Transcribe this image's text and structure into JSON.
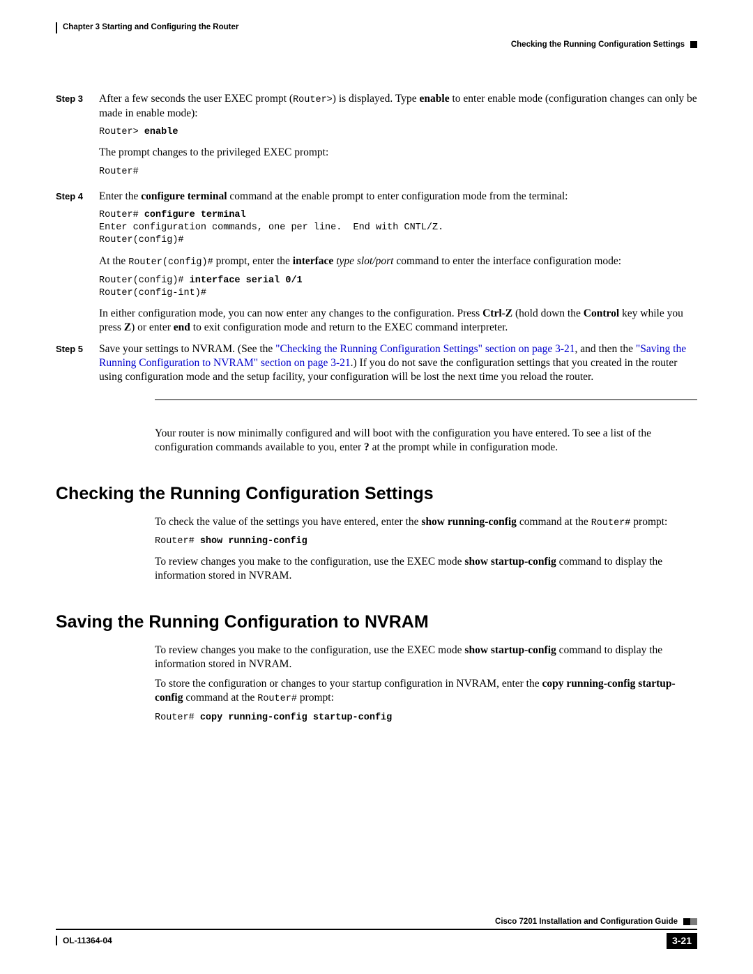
{
  "header": {
    "chapter": "Chapter 3      Starting and Configuring the Router",
    "section": "Checking the Running Configuration Settings"
  },
  "steps": {
    "s3": {
      "label": "Step 3",
      "p1_a": "After a few seconds the user EXEC prompt (",
      "p1_code": "Router>",
      "p1_b": ") is displayed. Type ",
      "p1_bold": "enable",
      "p1_c": " to enter enable mode (configuration changes can only be made in enable mode):",
      "code1_a": "Router> ",
      "code1_b": "enable",
      "p2": "The prompt changes to the privileged EXEC prompt:",
      "code2": "Router#"
    },
    "s4": {
      "label": "Step 4",
      "p1_a": "Enter the ",
      "p1_bold": "configure terminal",
      "p1_b": " command at the enable prompt to enter configuration mode from the terminal:",
      "code1_a": "Router# ",
      "code1_b": "configure terminal",
      "code1_c": "\nEnter configuration commands, one per line.  End with CNTL/Z.\nRouter(config)#",
      "p2_a": "At the ",
      "p2_code": "Router(config)#",
      "p2_b": " prompt, enter the ",
      "p2_bold": "interface",
      "p2_c": " ",
      "p2_italic": "type slot/port",
      "p2_d": " command to enter the interface configuration mode:",
      "code2_a": "Router(config)# ",
      "code2_b": "interface serial 0/1",
      "code2_c": "\nRouter(config-int)#",
      "p3_a": "In either configuration mode, you can now enter any changes to the configuration. Press ",
      "p3_b1": "Ctrl-Z",
      "p3_b": " (hold down the ",
      "p3_b2": "Control",
      "p3_c": " key while you press ",
      "p3_b3": "Z",
      "p3_d": ") or enter ",
      "p3_b4": "end",
      "p3_e": " to exit configuration mode and return to the EXEC command interpreter."
    },
    "s5": {
      "label": "Step 5",
      "p1_a": "Save your settings to NVRAM. (See the ",
      "link1": "\"Checking the Running Configuration Settings\" section on page 3-21",
      "p1_b": ", and then the ",
      "link2": "\"Saving the Running Configuration to NVRAM\" section on page 3-21",
      "p1_c": ".) If you do not save the configuration settings that you created in the router using configuration mode and the setup facility, your configuration will be lost the next time you reload the router."
    }
  },
  "after_steps": {
    "p1_a": "Your router is now minimally configured and will boot with the configuration you have entered. To see a list of the configuration commands available to you, enter ",
    "p1_bold": "?",
    "p1_b": " at the prompt while in configuration mode."
  },
  "sec1": {
    "title": "Checking the Running Configuration Settings",
    "p1_a": "To check the value of the settings you have entered, enter the ",
    "p1_bold": "show running-config",
    "p1_b": " command at the ",
    "p1_code": "Router#",
    "p1_c": " prompt:",
    "code_a": "Router# ",
    "code_b": "show running-config",
    "p2_a": "To review changes you make to the configuration, use the EXEC mode ",
    "p2_bold": "show startup-config",
    "p2_b": " command to display the information stored in NVRAM."
  },
  "sec2": {
    "title": "Saving the Running Configuration to NVRAM",
    "p1_a": "To review changes you make to the configuration, use the EXEC mode ",
    "p1_bold": "show startup-config",
    "p1_b": " command to display the information stored in NVRAM.",
    "p2_a": "To store the configuration or changes to your startup configuration in NVRAM, enter the ",
    "p2_bold": "copy running-config startup-config",
    "p2_b": " command at the ",
    "p2_code": "Router#",
    "p2_c": " prompt:",
    "code_a": "Router# ",
    "code_b": "copy running-config startup-config"
  },
  "footer": {
    "guide": "Cisco 7201 Installation and Configuration Guide",
    "doc": "OL-11364-04",
    "page": "3-21"
  }
}
